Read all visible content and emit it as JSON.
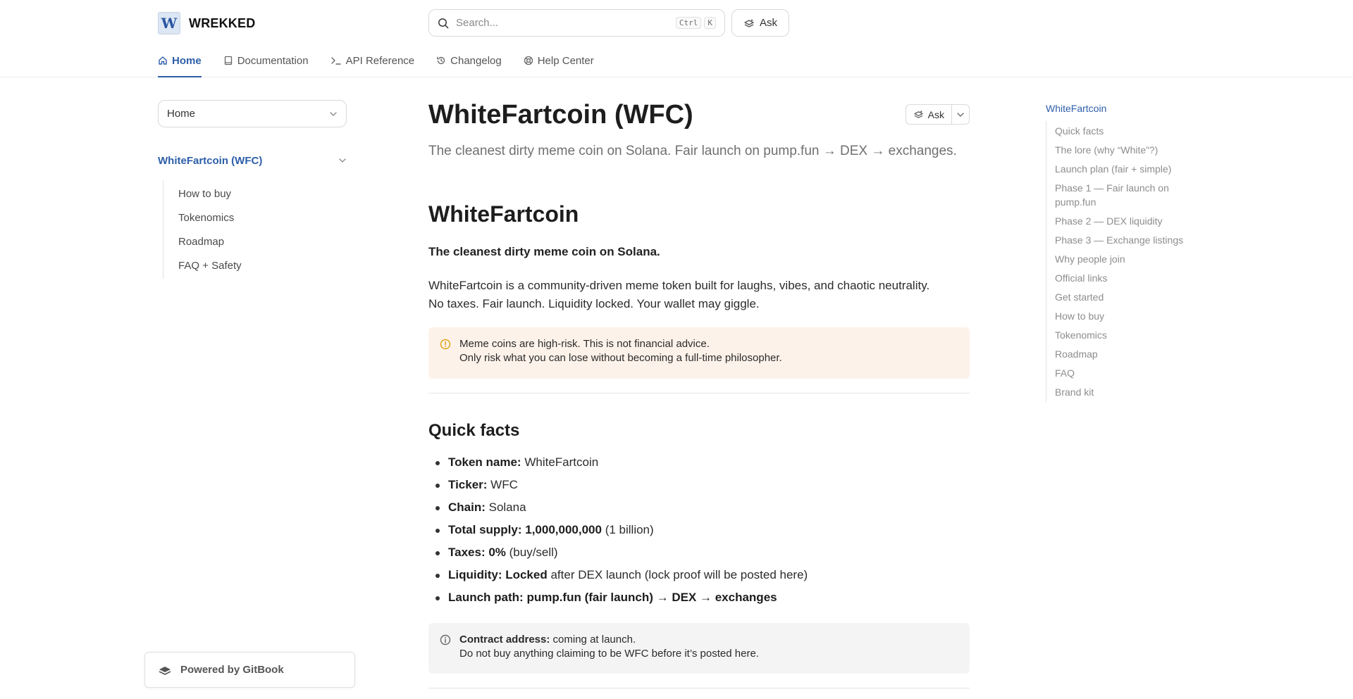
{
  "brand": {
    "logo_letter": "W",
    "name": "WREKKED"
  },
  "search": {
    "placeholder": "Search...",
    "kbd_ctrl": "Ctrl",
    "kbd_k": "K"
  },
  "header": {
    "ask_label": "Ask"
  },
  "tabs": [
    {
      "label": "Home",
      "icon": "home-icon",
      "active": true
    },
    {
      "label": "Documentation",
      "icon": "book-icon",
      "active": false
    },
    {
      "label": "API Reference",
      "icon": "terminal-icon",
      "active": false
    },
    {
      "label": "Changelog",
      "icon": "history-icon",
      "active": false
    },
    {
      "label": "Help Center",
      "icon": "lifebuoy-icon",
      "active": false
    }
  ],
  "sidebar": {
    "space_select": "Home",
    "parent": "WhiteFartcoin (WFC)",
    "children": [
      "How to buy",
      "Tokenomics",
      "Roadmap",
      "FAQ + Safety"
    ],
    "powered_by": "Powered by GitBook"
  },
  "page": {
    "title": "WhiteFartcoin (WFC)",
    "ask_label": "Ask",
    "description": "The cleanest dirty meme coin on Solana. Fair launch on pump.fun → DEX → exchanges.",
    "h1": "WhiteFartcoin",
    "lead": "The cleanest dirty meme coin on Solana.",
    "intro_line1": "WhiteFartcoin is a community-driven meme token built for laughs, vibes, and chaotic neutrality.",
    "intro_line2": "No taxes. Fair launch. Liquidity locked. Your wallet may giggle.",
    "warning_line1": "Meme coins are high-risk. This is not financial advice.",
    "warning_line2": "Only risk what you can lose without becoming a full-time philosopher.",
    "quick_facts_heading": "Quick facts",
    "facts": [
      {
        "label": "Token name:",
        "value": " WhiteFartcoin",
        "bold_value": ""
      },
      {
        "label": "Ticker:",
        "value": " WFC",
        "bold_value": ""
      },
      {
        "label": "Chain:",
        "value": " Solana",
        "bold_value": ""
      },
      {
        "label": "Total supply:",
        "bold_value": " 1,000,000,000",
        "value": " (1 billion)"
      },
      {
        "label": "Taxes:",
        "bold_value": " 0%",
        "value": " (buy/sell)"
      },
      {
        "label": "Liquidity:",
        "bold_value": " Locked",
        "value": " after DEX launch (lock proof will be posted here)"
      },
      {
        "label": "Launch path:",
        "bold_value": " pump.fun (fair launch) → DEX → exchanges",
        "value": ""
      }
    ],
    "contract_label": "Contract address:",
    "contract_value": " coming at launch.",
    "contract_line2": "Do not buy anything claiming to be WFC before it’s posted here."
  },
  "toc": {
    "top": "WhiteFartcoin",
    "items": [
      "Quick facts",
      "The lore (why “White”?)",
      "Launch plan (fair + simple)",
      "Phase 1 — Fair launch on pump.fun",
      "Phase 2 — DEX liquidity",
      "Phase 3 — Exchange listings",
      "Why people join",
      "Official links",
      "Get started",
      "How to buy",
      "Tokenomics",
      "Roadmap",
      "FAQ",
      "Brand kit"
    ]
  },
  "colors": {
    "accent": "#2d5ea8",
    "warning_bg": "#fdf2ea",
    "warning_icon": "#e0a21c",
    "info_bg": "#f4f4f4"
  }
}
